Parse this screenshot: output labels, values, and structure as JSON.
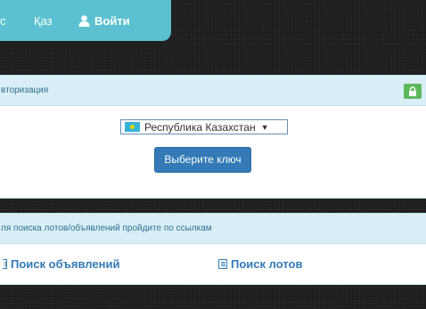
{
  "nav": {
    "cut_label": "с",
    "kaz_label": "Қаз",
    "login_label": "Войти"
  },
  "auth_panel": {
    "title": "вторизация",
    "country": "Республика Казахстан",
    "choose_key_label": "Выберите ключ"
  },
  "links_panel": {
    "title": "ля поиска лотов/объявлений пройдите по ссылкам",
    "ads_label": "Поиск объявлений",
    "lots_label": "Поиск лотов"
  },
  "colors": {
    "nav_bg": "#5bc0d0",
    "panel_header_bg": "#d9eef6",
    "primary": "#337ab7",
    "lock_green": "#5cb85c"
  }
}
